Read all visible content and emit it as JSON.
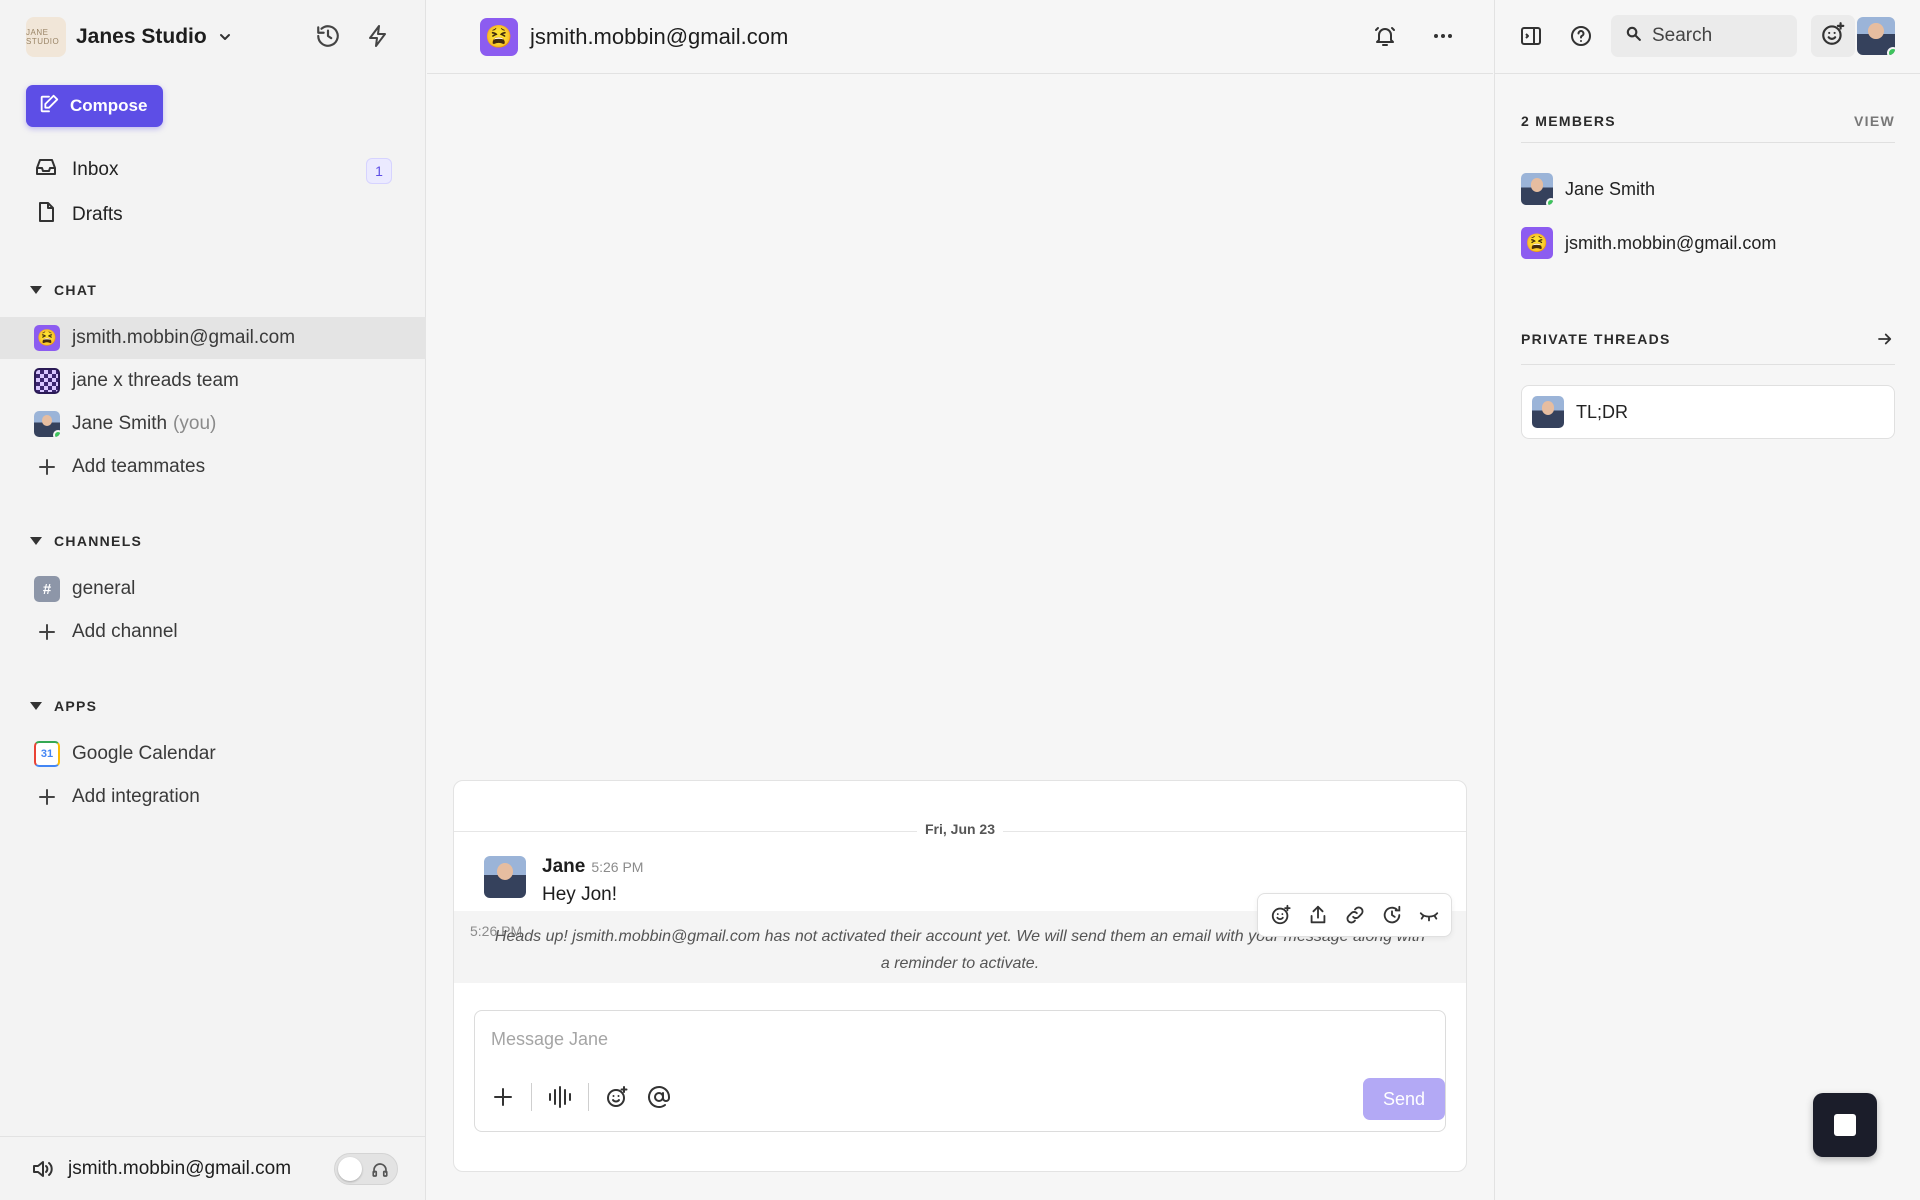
{
  "sidebar": {
    "workspace_logo_text": "JANE STUDIO",
    "workspace_name": "Janes Studio",
    "compose_label": "Compose",
    "inbox_label": "Inbox",
    "inbox_count": "1",
    "drafts_label": "Drafts",
    "sections": {
      "chat": "CHAT",
      "channels": "CHANNELS",
      "apps": "APPS"
    },
    "chat_items": [
      {
        "label": "jsmith.mobbin@gmail.com",
        "avatar": "emoji",
        "emoji": "😫"
      },
      {
        "label": "jane x threads team",
        "avatar": "checker"
      },
      {
        "label": "Jane Smith",
        "suffix": "(you)",
        "avatar": "person"
      }
    ],
    "add_teammates": "Add teammates",
    "channel_items": [
      {
        "label": "general",
        "glyph": "#"
      }
    ],
    "add_channel": "Add channel",
    "app_items": [
      {
        "label": "Google Calendar",
        "glyph": "31"
      }
    ],
    "add_integration": "Add integration",
    "footer_user": "jsmith.mobbin@gmail.com"
  },
  "main": {
    "header_title": "jsmith.mobbin@gmail.com",
    "header_emoji": "😫",
    "date_divider": "Fri, Jun 23",
    "message": {
      "author": "Jane",
      "time": "5:26 PM",
      "text": "Hey Jon!"
    },
    "notice": {
      "time": "5:26 PM",
      "text": "Heads up! jsmith.mobbin@gmail.com has not activated their account yet. We will send them an email with your message along with a reminder to activate."
    },
    "composer": {
      "placeholder": "Message Jane",
      "send_label": "Send"
    }
  },
  "right": {
    "search_label": "Search",
    "members_header": "2 MEMBERS",
    "view_label": "VIEW",
    "members": [
      {
        "name": "Jane Smith",
        "avatar": "person"
      },
      {
        "name": "jsmith.mobbin@gmail.com",
        "avatar": "emoji",
        "emoji": "😫"
      }
    ],
    "threads_header": "PRIVATE THREADS",
    "threads": [
      {
        "title": "TL;DR"
      }
    ]
  },
  "colors": {
    "accent": "#5d4ee6",
    "send_disabled": "#b3a9f5",
    "online": "#3ec45d"
  },
  "icons": [
    "history-icon",
    "bolt-icon",
    "compose-icon",
    "inbox-icon",
    "drafts-icon",
    "plus-icon",
    "bell-icon",
    "more-icon",
    "sidebar-toggle-icon",
    "help-icon",
    "search-icon",
    "add-reaction-icon",
    "share-icon",
    "link-icon",
    "remind-icon",
    "hide-icon",
    "voice-icon",
    "emoji-icon",
    "mention-icon",
    "speaker-icon",
    "headphones-icon",
    "arrow-right-icon",
    "stop-icon"
  ]
}
